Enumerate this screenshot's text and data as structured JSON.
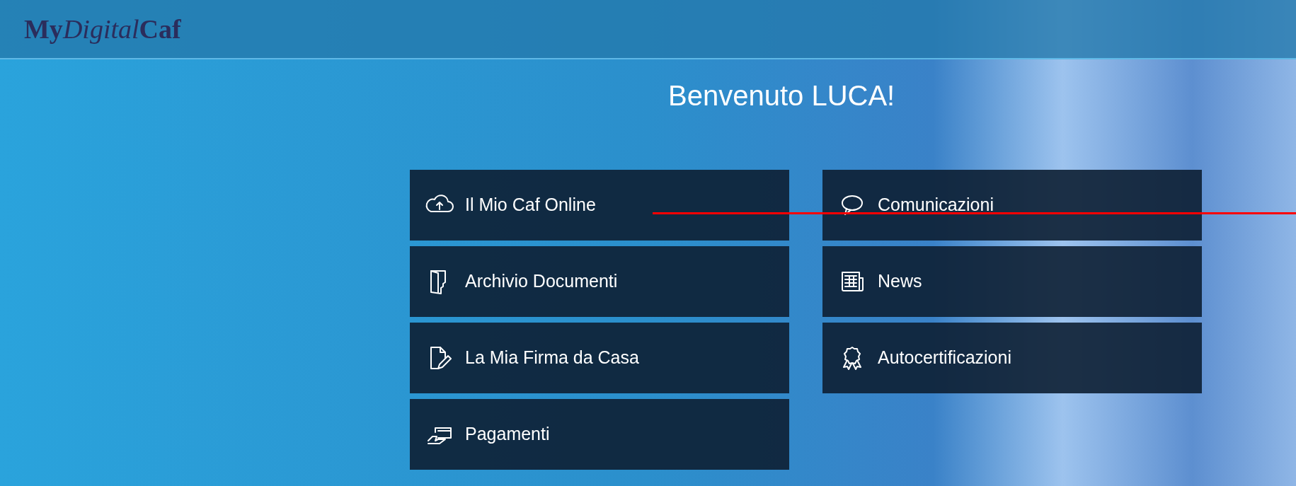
{
  "header": {
    "logo": [
      "My",
      "Digital",
      "Caf"
    ]
  },
  "welcome": "Benvenuto LUCA!",
  "menu_columns": [
    {
      "tiles": [
        {
          "label": "Il Mio Caf Online"
        },
        {
          "label": "Archivio Documenti"
        },
        {
          "label": "La Mia Firma da Casa"
        },
        {
          "label": "Pagamenti"
        }
      ]
    },
    {
      "tiles": [
        {
          "label": "Comunicazioni"
        },
        {
          "label": "News"
        },
        {
          "label": "Autocertificazioni"
        }
      ]
    }
  ]
}
